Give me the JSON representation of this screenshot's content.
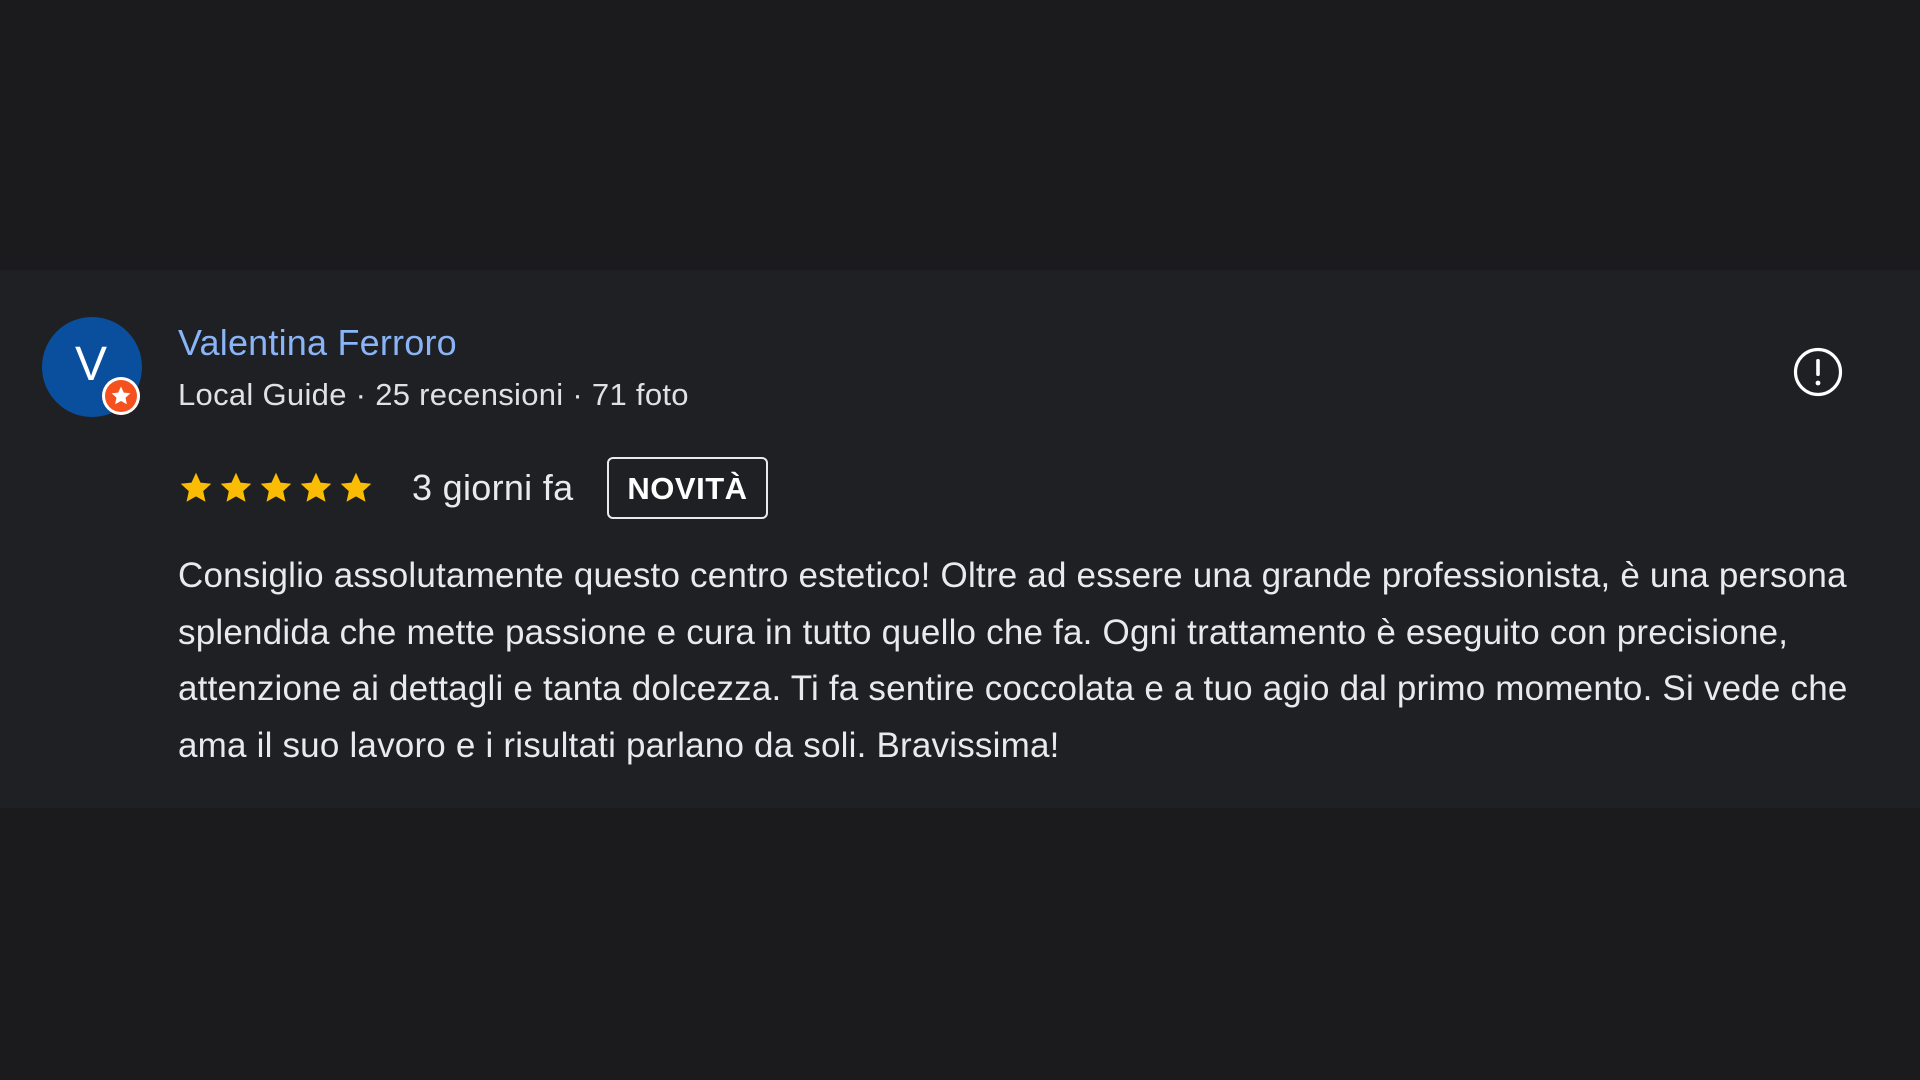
{
  "review": {
    "author_initial": "V",
    "author_name": "Valentina Ferroro",
    "author_meta": "Local Guide · 25 recensioni · 71 foto",
    "rating": 5,
    "rating_max": 5,
    "date": "3 giorni fa",
    "badge": "NOVITÀ",
    "text": "Consiglio assolutamente questo centro estetico! Oltre ad essere una grande professionista, è una persona splendida che mette passione e cura in tutto quello che fa. Ogni trattamento è eseguito con precisione, attenzione ai dettagli e tanta dolcezza. Ti fa sentire coccolata e a tuo agio dal primo momento. Si vede che ama il suo lavoro e i risultati parlano da soli. Bravissima!"
  },
  "icons": {
    "avatar_badge": "local-guide-star-icon",
    "report": "report-icon",
    "rating_star": "star-icon"
  },
  "colors": {
    "background": "#1b1b1d",
    "card": "#1f2023",
    "author_name": "#8ab4f8",
    "avatar": "#0a4f9d",
    "guide_badge": "#f4511e",
    "star": "#fbbc04",
    "text": "#e8eaed"
  }
}
